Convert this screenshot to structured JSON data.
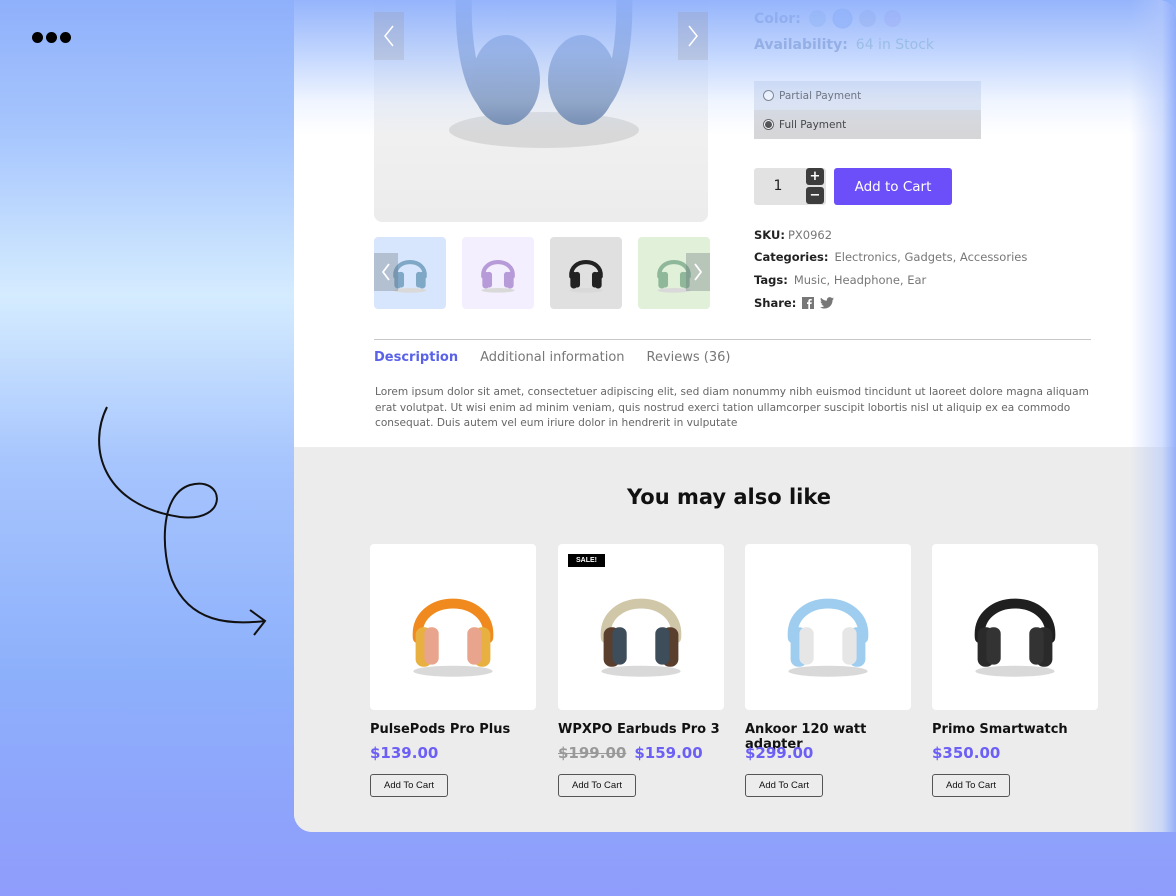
{
  "window": {
    "menu_icon": "three-dots-icon"
  },
  "product": {
    "color_label": "Color:",
    "colors": [
      "#b8d4e2",
      "#9ab8f5",
      "#c9c6d6",
      "#dcc0e8"
    ],
    "availability_label": "Availability:",
    "availability_value": "64 in Stock",
    "payment_options": [
      {
        "label": "Partial Payment",
        "selected": false
      },
      {
        "label": "Full Payment",
        "selected": true
      }
    ],
    "quantity": "1",
    "qty_plus": "+",
    "qty_minus": "−",
    "add_to_cart": "Add to Cart",
    "sku_label": "SKU:",
    "sku_value": "PX0962",
    "categories_label": "Categories:",
    "categories_value": "Electronics, Gadgets, Accessories",
    "tags_label": "Tags:",
    "tags_value": "Music, Headphone, Ear",
    "share_label": "Share:",
    "share_icons": [
      "facebook-icon",
      "twitter-icon"
    ],
    "thumbnails": [
      {
        "color": "blue",
        "bg": "#d8e6fd",
        "hp": "#7fa7c6"
      },
      {
        "color": "purple",
        "bg": "#f4effe",
        "hp": "#b79ad8"
      },
      {
        "color": "black",
        "bg": "#e0e0e0",
        "hp": "#222222"
      },
      {
        "color": "green",
        "bg": "#e1f0d9",
        "hp": "#8fb79a"
      }
    ]
  },
  "tabs": [
    {
      "label": "Description",
      "active": true
    },
    {
      "label": "Additional information",
      "active": false
    },
    {
      "label": "Reviews (36)",
      "active": false
    }
  ],
  "description": "Lorem ipsum dolor sit amet, consectetuer adipiscing elit, sed diam nonummy nibh euismod tincidunt ut laoreet dolore magna aliquam erat volutpat. Ut wisi enim ad minim veniam, quis nostrud exerci tation ullamcorper suscipit lobortis nisl ut aliquip ex ea commodo consequat. Duis autem vel eum iriure dolor in hendrerit in vulputate",
  "related": {
    "title": "You may also like",
    "products": [
      {
        "name": "PulsePods Pro Plus",
        "old_price": "",
        "price": "$139.00",
        "button": "Add To Cart",
        "badge": "",
        "band": "#f08a1e",
        "cup": "#e8b040",
        "pad": "#e8a48c"
      },
      {
        "name": "WPXPO Earbuds Pro 3",
        "old_price": "$199.00",
        "price": "$159.00",
        "button": "Add To Cart",
        "badge": "SALE!",
        "band": "#cfc7a8",
        "cup": "#5a3e2e",
        "pad": "#3e4d5a"
      },
      {
        "name": "Ankoor 120 watt adapter",
        "old_price": "",
        "price": "$299.00",
        "button": "Add To Cart",
        "badge": "",
        "band": "#9fcdef",
        "cup": "#9fcdef",
        "pad": "#e6e6e6"
      },
      {
        "name": "Primo Smartwatch",
        "old_price": "",
        "price": "$350.00",
        "button": "Add To Cart",
        "badge": "",
        "band": "#1f1f1f",
        "cup": "#2a2a2a",
        "pad": "#333333"
      }
    ]
  }
}
